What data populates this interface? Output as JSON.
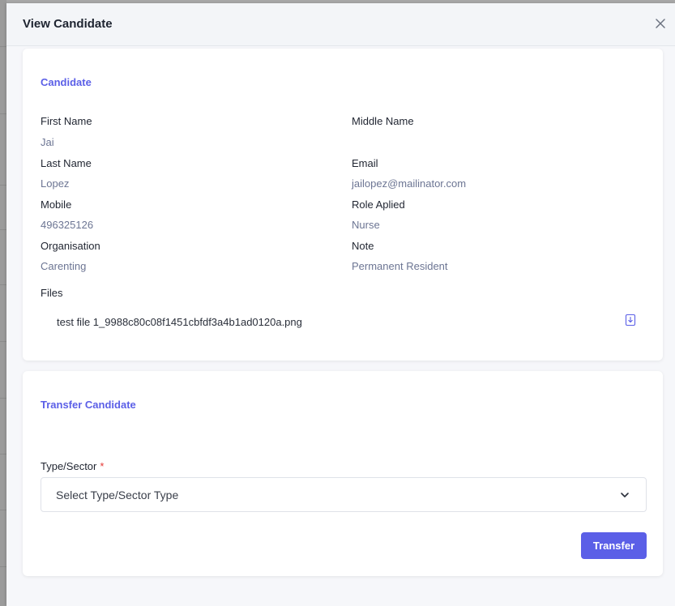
{
  "modal": {
    "title": "View Candidate"
  },
  "candidate": {
    "section_title": "Candidate",
    "fields": {
      "first_name": {
        "label": "First Name",
        "value": "Jai"
      },
      "middle_name": {
        "label": "Middle Name",
        "value": ""
      },
      "last_name": {
        "label": "Last Name",
        "value": "Lopez"
      },
      "email": {
        "label": "Email",
        "value": "jailopez@mailinator.com"
      },
      "mobile": {
        "label": "Mobile",
        "value": "496325126"
      },
      "role_applied": {
        "label": "Role Aplied",
        "value": "Nurse"
      },
      "organisation": {
        "label": "Organisation",
        "value": "Carenting"
      },
      "note": {
        "label": "Note",
        "value": "Permanent Resident"
      }
    },
    "files_label": "Files",
    "files": [
      {
        "name": "test file 1_9988c80c08f1451cbfdf3a4b1ad0120a.png"
      }
    ]
  },
  "transfer": {
    "section_title": "Transfer Candidate",
    "type_sector_label": "Type/Sector",
    "required_marker": "*",
    "select_placeholder": "Select Type/Sector Type",
    "button_label": "Transfer"
  },
  "colors": {
    "accent": "#5b5fe7",
    "value_text": "#6c7593",
    "required": "#e53935"
  },
  "icons": {
    "close": "close-icon",
    "download": "download-icon",
    "chevron": "chevron-down-icon"
  }
}
